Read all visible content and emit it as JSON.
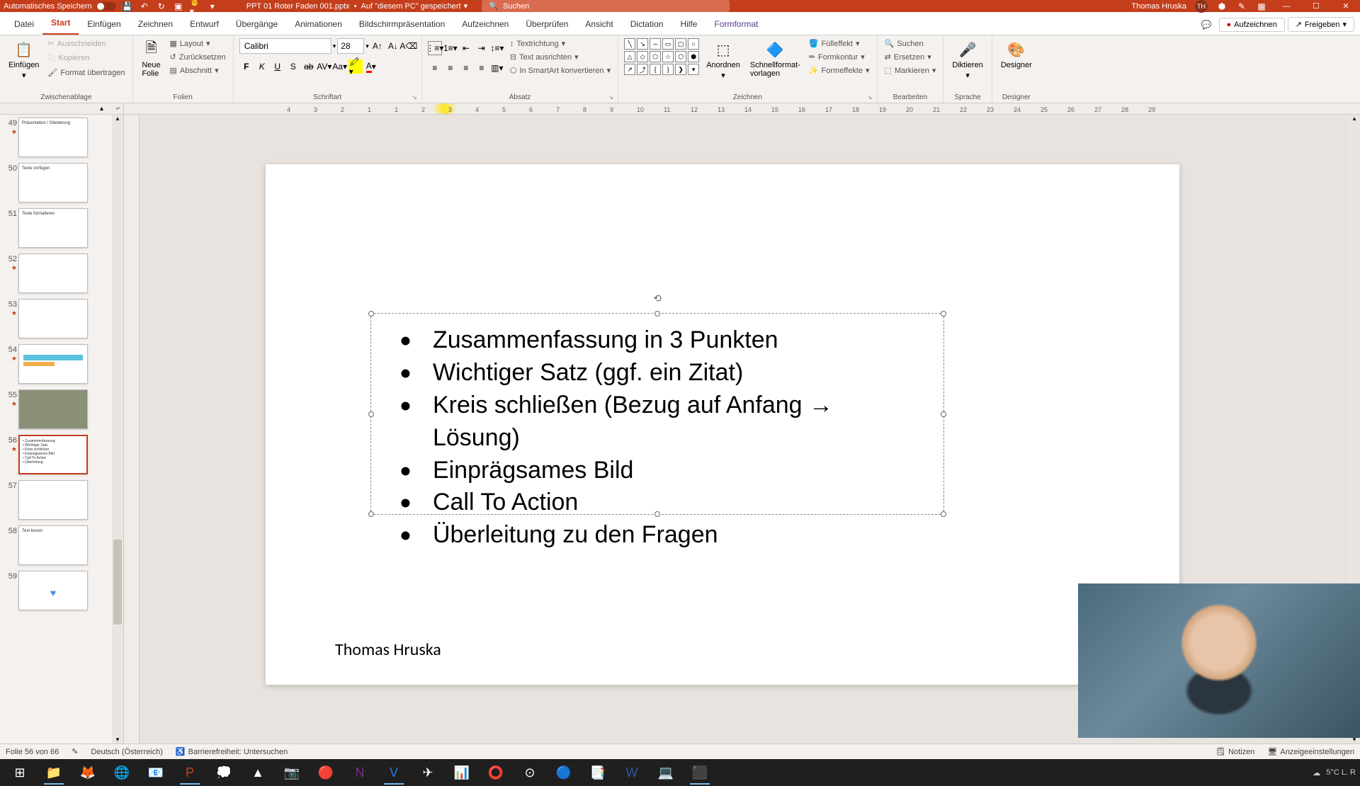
{
  "titlebar": {
    "autosave": "Automatisches Speichern",
    "filename": "PPT 01 Roter Faden 001.pptx",
    "saved_location": "Auf \"diesem PC\" gespeichert",
    "search_placeholder": "Suchen",
    "username": "Thomas Hruska",
    "user_initials": "TH"
  },
  "tabs": {
    "file": "Datei",
    "start": "Start",
    "insert": "Einfügen",
    "draw": "Zeichnen",
    "design": "Entwurf",
    "transitions": "Übergänge",
    "animations": "Animationen",
    "slideshow": "Bildschirmpräsentation",
    "record": "Aufzeichnen",
    "review": "Überprüfen",
    "view": "Ansicht",
    "dictation": "Dictation",
    "help": "Hilfe",
    "shapeformat": "Formformat",
    "record_btn": "Aufzeichnen",
    "share_btn": "Freigeben"
  },
  "ribbon": {
    "clipboard": {
      "label": "Zwischenablage",
      "paste": "Einfügen",
      "cut": "Ausschneiden",
      "copy": "Kopieren",
      "format_painter": "Format übertragen"
    },
    "slides": {
      "label": "Folien",
      "new_slide": "Neue\nFolie",
      "layout": "Layout",
      "reset": "Zurücksetzen",
      "section": "Abschnitt"
    },
    "font": {
      "label": "Schriftart",
      "name": "Calibri",
      "size": "28"
    },
    "paragraph": {
      "label": "Absatz",
      "text_direction": "Textrichtung",
      "align_text": "Text ausrichten",
      "smartart": "In SmartArt konvertieren"
    },
    "drawing": {
      "label": "Zeichnen",
      "arrange": "Anordnen",
      "quick_styles": "Schnellformat-\nvorlagen",
      "fill": "Fülleffekt",
      "outline": "Formkontur",
      "effects": "Formeffekte"
    },
    "editing": {
      "label": "Bearbeiten",
      "find": "Suchen",
      "replace": "Ersetzen",
      "select": "Markieren"
    },
    "voice": {
      "label": "Sprache",
      "dictate": "Diktieren"
    },
    "designer": {
      "label": "Designer",
      "btn": "Designer"
    }
  },
  "ruler": {
    "marks": [
      "4",
      "3",
      "2",
      "1",
      "1",
      "2",
      "3",
      "4",
      "5",
      "6",
      "7",
      "8",
      "9",
      "10",
      "11",
      "12",
      "13",
      "14",
      "15",
      "16",
      "17",
      "18",
      "19",
      "20",
      "21",
      "22",
      "23",
      "24",
      "25",
      "26",
      "27",
      "28",
      "29"
    ]
  },
  "thumbs": [
    {
      "num": "49",
      "star": true,
      "title": "Präsentation / Gliederung"
    },
    {
      "num": "50",
      "title": "Texte vorfügen"
    },
    {
      "num": "51",
      "title": "Texte formatieren"
    },
    {
      "num": "52",
      "star": true,
      "title": ""
    },
    {
      "num": "53",
      "star": true,
      "title": ""
    },
    {
      "num": "54",
      "star": true,
      "title": ""
    },
    {
      "num": "55",
      "star": true,
      "title": ""
    },
    {
      "num": "56",
      "star": true,
      "title": "",
      "active": true
    },
    {
      "num": "57",
      "title": ""
    },
    {
      "num": "58",
      "title": "Text boxen"
    },
    {
      "num": "59",
      "title": ""
    }
  ],
  "slide": {
    "bullets": [
      "Zusammenfassung in 3 Punkten",
      "Wichtiger Satz (ggf. ein Zitat)",
      "Kreis schließen (Bezug auf Anfang → Lösung)",
      "Einprägsames Bild",
      "Call To Action",
      "Überleitung zu den Fragen"
    ],
    "author": "Thomas Hruska"
  },
  "statusbar": {
    "slide_info": "Folie 56 von 66",
    "language": "Deutsch (Österreich)",
    "accessibility": "Barrierefreiheit: Untersuchen",
    "notes": "Notizen",
    "display_settings": "Anzeigeeinstellungen"
  },
  "taskbar": {
    "weather": "5°C  L. R"
  }
}
